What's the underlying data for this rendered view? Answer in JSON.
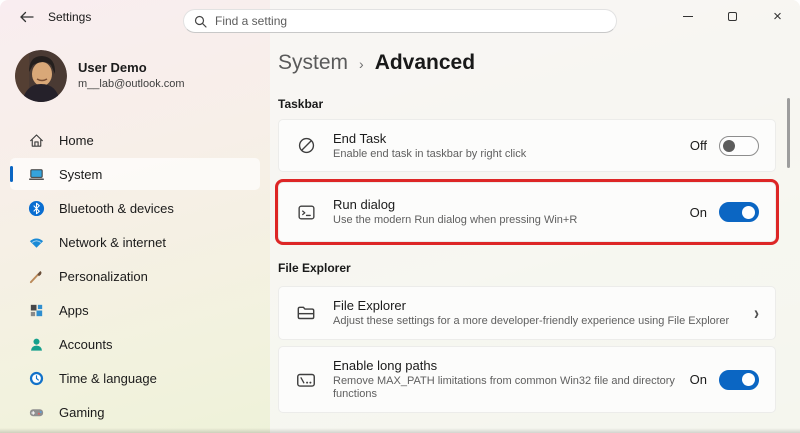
{
  "window": {
    "title": "Settings",
    "controls": {
      "minimize": "minimize",
      "maximize": "maximize",
      "close": "close",
      "close_glyph": "×"
    }
  },
  "search": {
    "placeholder": "Find a setting",
    "icon": "search-icon"
  },
  "user": {
    "name": "User Demo",
    "email": "m__lab@outlook.com",
    "avatar": "avatar"
  },
  "sidebar": {
    "items": [
      {
        "label": "Home",
        "icon": "home-icon",
        "selected": false
      },
      {
        "label": "System",
        "icon": "system-icon",
        "selected": true
      },
      {
        "label": "Bluetooth & devices",
        "icon": "bluetooth-icon",
        "selected": false
      },
      {
        "label": "Network & internet",
        "icon": "network-icon",
        "selected": false
      },
      {
        "label": "Personalization",
        "icon": "personalization-icon",
        "selected": false
      },
      {
        "label": "Apps",
        "icon": "apps-icon",
        "selected": false
      },
      {
        "label": "Accounts",
        "icon": "accounts-icon",
        "selected": false
      },
      {
        "label": "Time & language",
        "icon": "time-language-icon",
        "selected": false
      },
      {
        "label": "Gaming",
        "icon": "gaming-icon",
        "selected": false
      }
    ]
  },
  "breadcrumb": {
    "parent": "System",
    "separator": "›",
    "current": "Advanced"
  },
  "sections": [
    {
      "title": "Taskbar",
      "cards": [
        {
          "icon": "block-icon",
          "title": "End Task",
          "subtitle": "Enable end task in taskbar by right click",
          "control": "toggle",
          "state_label": "Off",
          "on": false,
          "highlight": false
        },
        {
          "icon": "run-dialog-icon",
          "title": "Run dialog",
          "subtitle": "Use the modern Run dialog when pressing Win+R",
          "control": "toggle",
          "state_label": "On",
          "on": true,
          "highlight": true
        }
      ]
    },
    {
      "title": "File Explorer",
      "cards": [
        {
          "icon": "folder-icon",
          "title": "File Explorer",
          "subtitle": "Adjust these settings for a more developer-friendly experience using File Explorer",
          "control": "chevron",
          "chevron_glyph": "›"
        },
        {
          "icon": "long-path-icon",
          "title": "Enable long paths",
          "subtitle": "Remove MAX_PATH limitations from common Win32 file and directory functions",
          "control": "toggle",
          "state_label": "On",
          "on": true,
          "highlight": false
        }
      ]
    }
  ],
  "colors": {
    "accent": "#0b66c3",
    "highlight_border": "#dd2626",
    "toggle_off_knob": "#5c5c5c"
  }
}
